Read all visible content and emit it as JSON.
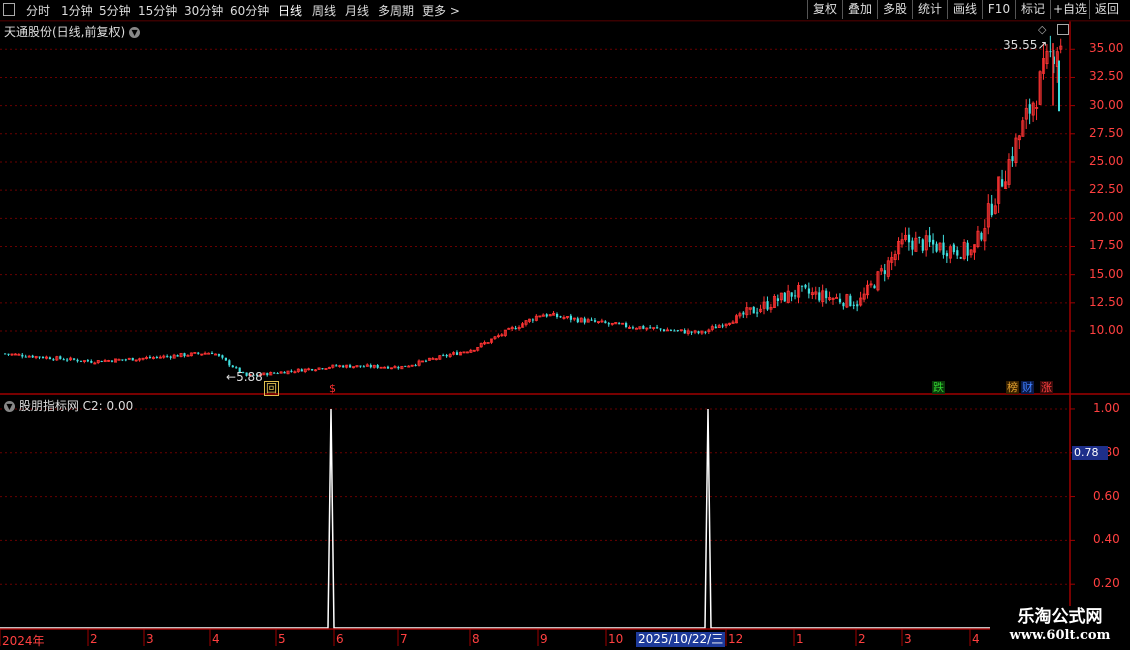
{
  "toolbar": {
    "periods": [
      "分时",
      "1分钟",
      "5分钟",
      "15分钟",
      "30分钟",
      "60分钟",
      "日线",
      "周线",
      "月线",
      "多周期",
      "更多"
    ],
    "active": "日线",
    "right_buttons": [
      "复权",
      "叠加",
      "多股",
      "统计",
      "画线",
      "F10",
      "标记",
      "+自选",
      "返回"
    ]
  },
  "main_chart": {
    "title": "天通股份(日线,前复权)",
    "y_ticks": [
      "35.00",
      "32.50",
      "30.00",
      "27.50",
      "25.00",
      "22.50",
      "20.00",
      "17.50",
      "15.00",
      "12.50",
      "10.00"
    ],
    "high_label": "35.55",
    "low_label": "5.88",
    "markers": [
      {
        "text": "回",
        "color": "#e0c050"
      },
      {
        "text": "$",
        "color": "#ff3030"
      },
      {
        "text": "跌",
        "color": "#30d030"
      },
      {
        "text": "榜",
        "color": "#e0a030"
      },
      {
        "text": "财",
        "color": "#4080ff"
      },
      {
        "text": "涨",
        "color": "#ff4040"
      }
    ]
  },
  "indicator": {
    "title": "股朋指标网 C2: 0.00",
    "y_ticks": [
      "1.00",
      "0.80",
      "0.60",
      "0.40",
      "0.20"
    ],
    "current_value": "0.78"
  },
  "x_axis": {
    "labels": [
      "2024年",
      "2",
      "3",
      "4",
      "5",
      "6",
      "7",
      "8",
      "9",
      "10",
      "12",
      "1",
      "2",
      "3",
      "4"
    ],
    "highlight_date": "2025/10/22/三"
  },
  "watermark": {
    "line1": "乐淘公式网",
    "line2": "www.60lt.com"
  },
  "colors": {
    "up": "#ff3333",
    "down": "#40e0e0",
    "grid": "#6a0000",
    "axis": "#a00000",
    "indicator_line": "#ffffff"
  },
  "chart_data": {
    "type": "candlestick",
    "title": "天通股份(日线,前复权)",
    "key_points": [
      {
        "x": "2024年",
        "y": 8.0
      },
      {
        "x": "2",
        "y": 7.3
      },
      {
        "x": "3",
        "y": 7.6
      },
      {
        "x": "4",
        "y": 8.1
      },
      {
        "x": "5",
        "y": 6.0
      },
      {
        "x": "6",
        "y": 6.9
      },
      {
        "x": "7",
        "y": 6.8
      },
      {
        "x": "8",
        "y": 8.4
      },
      {
        "x": "9",
        "y": 11.5
      },
      {
        "x": "10",
        "y": 10.6
      },
      {
        "x": "12",
        "y": 9.8
      },
      {
        "x": "1",
        "y": 13.5
      },
      {
        "x": "2",
        "y": 12.5
      },
      {
        "x": "3",
        "y": 18.0
      },
      {
        "x": "4",
        "y": 17.0
      },
      {
        "x": "4",
        "y": 35.55
      }
    ],
    "period_high": 35.55,
    "period_low": 5.88,
    "ylim": [
      4.5,
      36.0
    ],
    "indicator": {
      "name": "C2",
      "spikes_at": [
        "6",
        "2025/10/22/三"
      ],
      "spike_value": 1.0,
      "baseline": 0.0,
      "ylim": [
        0,
        1.05
      ]
    }
  }
}
